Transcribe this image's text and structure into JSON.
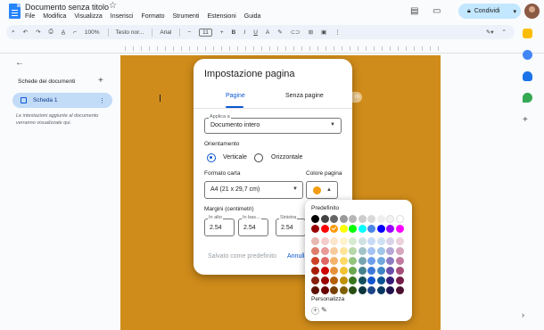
{
  "app": {
    "doc_title": "Documento senza titolo",
    "menu": [
      "File",
      "Modifica",
      "Visualizza",
      "Inserisci",
      "Formato",
      "Strumenti",
      "Estensioni",
      "Guida"
    ],
    "share_label": "Condividi"
  },
  "toolbar": {
    "zoom": "100%",
    "style": "Testo nor...",
    "font": "Arial",
    "font_size": "11"
  },
  "sidebar": {
    "heading": "Schede dei documenti",
    "tab_label": "Scheda 1",
    "hint": "Le intestazioni aggiunte al documento verranno visualizzate qui."
  },
  "dialog": {
    "title": "Impostazione pagina",
    "tabs": [
      "Pagine",
      "Senza pagine"
    ],
    "apply_label": "Applica a",
    "apply_value": "Documento intero",
    "orientation_label": "Orientamento",
    "orientation_options": [
      "Verticale",
      "Orizzontale"
    ],
    "paper_label": "Formato carta",
    "paper_value": "A4 (21 x 29,7 cm)",
    "page_color_label": "Colore pagina",
    "page_color": "#f39c12",
    "margins_label": "Margini (centimetri)",
    "margins": [
      {
        "label": "In alto",
        "value": "2.54"
      },
      {
        "label": "In bas...",
        "value": "2.54"
      },
      {
        "label": "Sinistra",
        "value": "2.54"
      }
    ],
    "save_default": "Salvato come predefinito",
    "cancel": "Annulla"
  },
  "palette": {
    "default_label": "Predefinito",
    "custom_label": "Personalizza",
    "selected_color": "#ff9900",
    "rows": [
      [
        "#000000",
        "#434343",
        "#666666",
        "#999999",
        "#b7b7b7",
        "#cccccc",
        "#d9d9d9",
        "#efefef",
        "#f3f3f3",
        "#ffffff"
      ],
      [
        "#980000",
        "#ff0000",
        "#ff9900",
        "#ffff00",
        "#00ff00",
        "#00ffff",
        "#4a86e8",
        "#0000ff",
        "#9900ff",
        "#ff00ff"
      ],
      [
        "#e6b8af",
        "#f4cccc",
        "#fce5cd",
        "#fff2cc",
        "#d9ead3",
        "#d0e0e3",
        "#c9daf8",
        "#cfe2f3",
        "#d9d2e9",
        "#ead1dc"
      ],
      [
        "#dd7e6b",
        "#ea9999",
        "#f9cb9c",
        "#ffe599",
        "#b6d7a8",
        "#a2c4c9",
        "#a4c2f4",
        "#9fc5e8",
        "#b4a7d6",
        "#d5a6bd"
      ],
      [
        "#cc4125",
        "#e06666",
        "#f6b26b",
        "#ffd966",
        "#93c47d",
        "#76a5af",
        "#6d9eeb",
        "#6fa8dc",
        "#8e7cc3",
        "#c27ba0"
      ],
      [
        "#a61c00",
        "#cc0000",
        "#e69138",
        "#f1c232",
        "#6aa84f",
        "#45818e",
        "#3c78d8",
        "#3d85c6",
        "#674ea7",
        "#a64d79"
      ],
      [
        "#85200c",
        "#990000",
        "#b45f06",
        "#bf9000",
        "#38761d",
        "#134f5c",
        "#1155cc",
        "#0b5394",
        "#351c75",
        "#741b47"
      ],
      [
        "#5b0f00",
        "#660000",
        "#783f04",
        "#7f6000",
        "#274e13",
        "#0c343d",
        "#1c4587",
        "#073763",
        "#20124d",
        "#4c1130"
      ]
    ]
  },
  "page": {
    "background": "#d08c1a"
  }
}
